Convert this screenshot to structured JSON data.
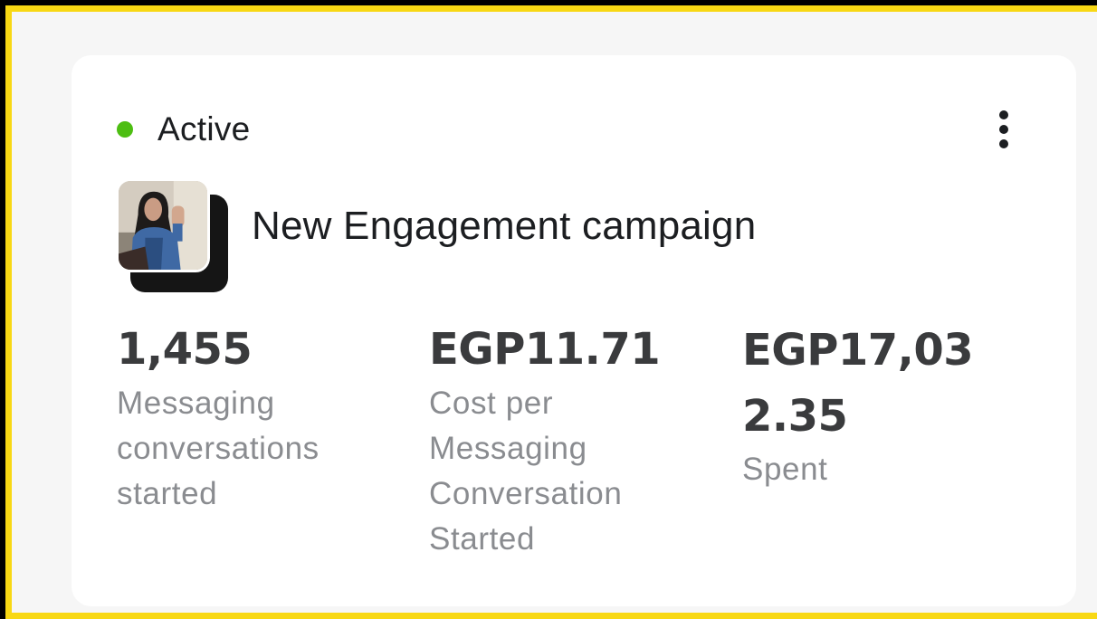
{
  "status": {
    "label": "Active",
    "color": "#4DBE12"
  },
  "menu": {
    "icon": "more-vertical-icon"
  },
  "campaign": {
    "name": "New Engagement campaign",
    "thumbnail_icon": "ad-creative-thumbnail"
  },
  "metrics": [
    {
      "value": "1,455",
      "label": "Messaging conversations started"
    },
    {
      "value": "EGP11.71",
      "label": "Cost per Messaging Conversation Started"
    },
    {
      "value": "EGP17,032.35",
      "label": "Spent"
    }
  ],
  "colors": {
    "frame_border": "#F8D814",
    "card_background": "#FFFFFF",
    "value_text": "#3A3B3D",
    "label_text": "#8A8C90"
  }
}
